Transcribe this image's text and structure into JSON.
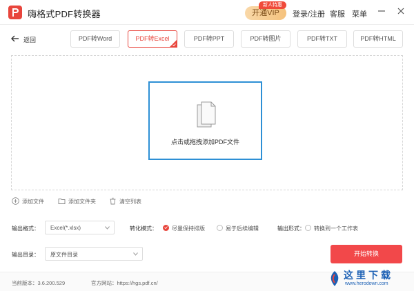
{
  "app": {
    "title": "嗨格式PDF转换器"
  },
  "header": {
    "vip_label": "开通VIP",
    "vip_badge": "新人特惠",
    "login_label": "登录/注册",
    "service_label": "客服",
    "menu_label": "菜单"
  },
  "nav": {
    "back_label": "返回"
  },
  "tabs": [
    {
      "label": "PDF转Word"
    },
    {
      "label": "PDF转Excel",
      "active": true
    },
    {
      "label": "PDF转PPT"
    },
    {
      "label": "PDF转图片"
    },
    {
      "label": "PDF转TXT"
    },
    {
      "label": "PDF转HTML"
    }
  ],
  "drop": {
    "label": "点击或拖拽添加PDF文件"
  },
  "file_actions": {
    "add_file": "添加文件",
    "add_folder": "添加文件夹",
    "clear_list": "清空列表"
  },
  "settings": {
    "output_format_label": "输出格式：",
    "output_format_value": "Excel(*.xlsx)",
    "convert_mode_label": "转化模式：",
    "mode_options": [
      {
        "label": "尽量保持排版",
        "selected": true
      },
      {
        "label": "易于后续编辑",
        "selected": false
      }
    ],
    "output_form_label": "输出形式：",
    "output_form_option": "转换到一个工作表",
    "output_dir_label": "输出目录：",
    "output_dir_value": "原文件目录",
    "start_label": "开始转换"
  },
  "footer": {
    "version_label": "当前版本：3.6.200.529",
    "website_label": "官方网站：https://hgs.pdf.cn/"
  },
  "watermark": {
    "text": "这里下载",
    "url": "www.herodown.com"
  },
  "colors": {
    "accent": "#e8453c",
    "highlight": "#2d8fd5",
    "start_button": "#f2484a"
  }
}
